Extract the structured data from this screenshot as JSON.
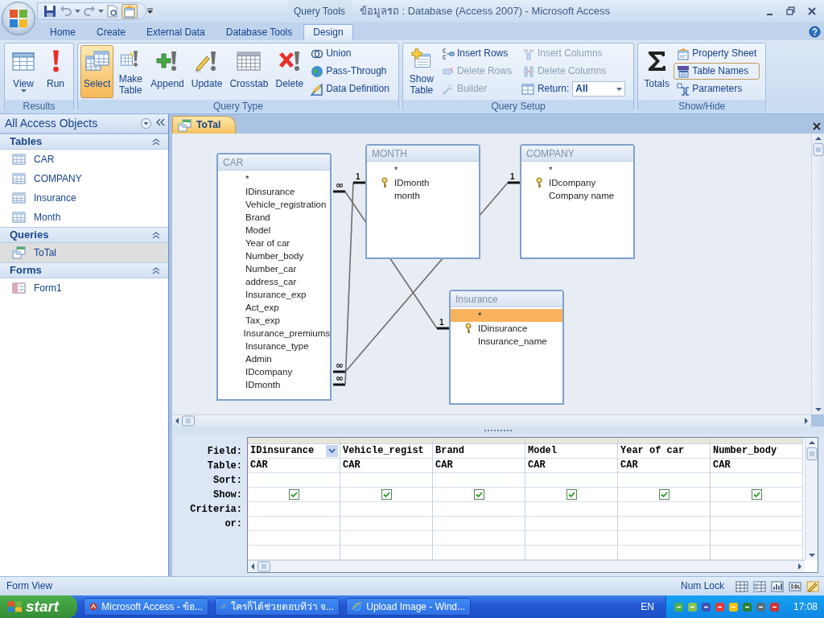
{
  "window": {
    "title": "ข้อมูลรถ : Database (Access 2007) - Microsoft Access",
    "context_tools": "Query Tools"
  },
  "ribbon_tabs": [
    {
      "label": "Home",
      "selected": false
    },
    {
      "label": "Create",
      "selected": false
    },
    {
      "label": "External Data",
      "selected": false
    },
    {
      "label": "Database Tools",
      "selected": false
    },
    {
      "label": "Design",
      "selected": true
    }
  ],
  "ribbon_groups": [
    {
      "name": "Results",
      "items": [
        {
          "kind": "large-menu",
          "label": "View",
          "selected": false,
          "disabled": false
        },
        {
          "kind": "large",
          "label": "Run",
          "selected": false,
          "disabled": false
        }
      ]
    },
    {
      "name": "Query Type",
      "items": [
        {
          "kind": "large",
          "label": "Select",
          "selected": true,
          "disabled": false
        },
        {
          "kind": "large",
          "label": "Make\nTable",
          "selected": false,
          "disabled": false
        },
        {
          "kind": "large",
          "label": "Append",
          "selected": false,
          "disabled": false
        },
        {
          "kind": "large",
          "label": "Update",
          "selected": false,
          "disabled": false
        },
        {
          "kind": "large",
          "label": "Crosstab",
          "selected": false,
          "disabled": false
        },
        {
          "kind": "large",
          "label": "Delete",
          "selected": false,
          "disabled": false
        },
        {
          "kind": "small",
          "label": "Union",
          "selected": false,
          "disabled": false
        },
        {
          "kind": "small",
          "label": "Pass-Through",
          "selected": false,
          "disabled": false
        },
        {
          "kind": "small",
          "label": "Data Definition",
          "selected": false,
          "disabled": false
        }
      ]
    },
    {
      "name": "Query Setup",
      "items": [
        {
          "kind": "large",
          "label": "Show\nTable",
          "selected": false,
          "disabled": false
        },
        {
          "kind": "small",
          "label": "Insert Rows",
          "selected": false,
          "disabled": false
        },
        {
          "kind": "small",
          "label": "Delete Rows",
          "selected": false,
          "disabled": true
        },
        {
          "kind": "small",
          "label": "Builder",
          "selected": false,
          "disabled": true
        },
        {
          "kind": "small",
          "label": "Insert Columns",
          "selected": false,
          "disabled": true
        },
        {
          "kind": "small",
          "label": "Delete Columns",
          "selected": false,
          "disabled": true
        },
        {
          "kind": "select",
          "label": "Return:",
          "value": "All"
        }
      ]
    },
    {
      "name": "Show/Hide",
      "items": [
        {
          "kind": "large",
          "label": "Totals",
          "selected": false,
          "disabled": false
        },
        {
          "kind": "small",
          "label": "Property Sheet",
          "selected": false,
          "disabled": false
        },
        {
          "kind": "small",
          "label": "Table Names",
          "selected": true,
          "disabled": false
        },
        {
          "kind": "small",
          "label": "Parameters",
          "selected": false,
          "disabled": false
        }
      ]
    }
  ],
  "navigation": {
    "title": "All Access Objects",
    "groups": [
      {
        "name": "Tables",
        "items": [
          {
            "kind": "table",
            "label": "CAR",
            "selected": false
          },
          {
            "kind": "table",
            "label": "COMPANY",
            "selected": false
          },
          {
            "kind": "table",
            "label": "Insurance",
            "selected": false
          },
          {
            "kind": "table",
            "label": "Month",
            "selected": false
          }
        ]
      },
      {
        "name": "Queries",
        "items": [
          {
            "kind": "query",
            "label": "ToTal",
            "selected": true
          }
        ]
      },
      {
        "name": "Forms",
        "items": [
          {
            "kind": "form",
            "label": "Form1",
            "selected": false
          }
        ]
      }
    ]
  },
  "document_tab": {
    "label": "ToTal"
  },
  "diagram": {
    "tables": [
      {
        "title": "CAR",
        "fields": [
          {
            "name": "*",
            "key": false,
            "selected": false
          },
          {
            "name": "IDinsurance",
            "key": false,
            "selected": false
          },
          {
            "name": "Vehicle_registration",
            "key": false,
            "selected": false
          },
          {
            "name": "Brand",
            "key": false,
            "selected": false
          },
          {
            "name": "Model",
            "key": false,
            "selected": false
          },
          {
            "name": "Year of car",
            "key": false,
            "selected": false
          },
          {
            "name": "Number_body",
            "key": false,
            "selected": false
          },
          {
            "name": "Number_car",
            "key": false,
            "selected": false
          },
          {
            "name": "address_car",
            "key": false,
            "selected": false
          },
          {
            "name": "Insurance_exp",
            "key": false,
            "selected": false
          },
          {
            "name": "Act_exp",
            "key": false,
            "selected": false
          },
          {
            "name": "Tax_exp",
            "key": false,
            "selected": false
          },
          {
            "name": "Insurance_premiums",
            "key": false,
            "selected": false
          },
          {
            "name": "Insurance_type",
            "key": false,
            "selected": false
          },
          {
            "name": "Admin",
            "key": false,
            "selected": false
          },
          {
            "name": "IDcompany",
            "key": false,
            "selected": false
          },
          {
            "name": "IDmonth",
            "key": false,
            "selected": false
          }
        ]
      },
      {
        "title": "MONTH",
        "fields": [
          {
            "name": "*",
            "key": false,
            "selected": false
          },
          {
            "name": "IDmonth",
            "key": true,
            "selected": false
          },
          {
            "name": "month",
            "key": false,
            "selected": false
          }
        ]
      },
      {
        "title": "COMPANY",
        "fields": [
          {
            "name": "*",
            "key": false,
            "selected": false
          },
          {
            "name": "IDcompany",
            "key": true,
            "selected": false
          },
          {
            "name": "Company name",
            "key": false,
            "selected": false
          }
        ]
      },
      {
        "title": "Insurance",
        "fields": [
          {
            "name": "*",
            "key": false,
            "selected": true
          },
          {
            "name": "IDinsurance",
            "key": true,
            "selected": false
          },
          {
            "name": "Insurance_name",
            "key": false,
            "selected": false
          }
        ]
      }
    ],
    "relationships": [
      {
        "many_label": "∞",
        "one_label": "1"
      },
      {
        "many_label": "∞",
        "one_label": "1"
      },
      {
        "many_label": "∞",
        "one_label": "1"
      }
    ]
  },
  "grid": {
    "row_labels": [
      "Field:",
      "Table:",
      "Sort:",
      "Show:",
      "Criteria:",
      "or:"
    ],
    "columns": [
      {
        "field": "IDinsurance",
        "table": "CAR",
        "show": true,
        "focused": true
      },
      {
        "field": "Vehicle_regist",
        "table": "CAR",
        "show": true,
        "focused": false
      },
      {
        "field": "Brand",
        "table": "CAR",
        "show": true,
        "focused": false
      },
      {
        "field": "Model",
        "table": "CAR",
        "show": true,
        "focused": false
      },
      {
        "field": "Year of car",
        "table": "CAR",
        "show": true,
        "focused": false
      },
      {
        "field": "Number_body",
        "table": "CAR",
        "show": true,
        "focused": false
      }
    ]
  },
  "status_bar": {
    "left": "Form View",
    "right": "Num Lock"
  },
  "taskbar": {
    "start": "start",
    "tasks": [
      {
        "label": "Microsoft Access - ข้อ..."
      },
      {
        "label": "ใครก็ได้ช่วยตอบทีว่า จ..."
      },
      {
        "label": "Upload Image - Wind..."
      }
    ],
    "language": "EN",
    "clock": "17:08"
  }
}
